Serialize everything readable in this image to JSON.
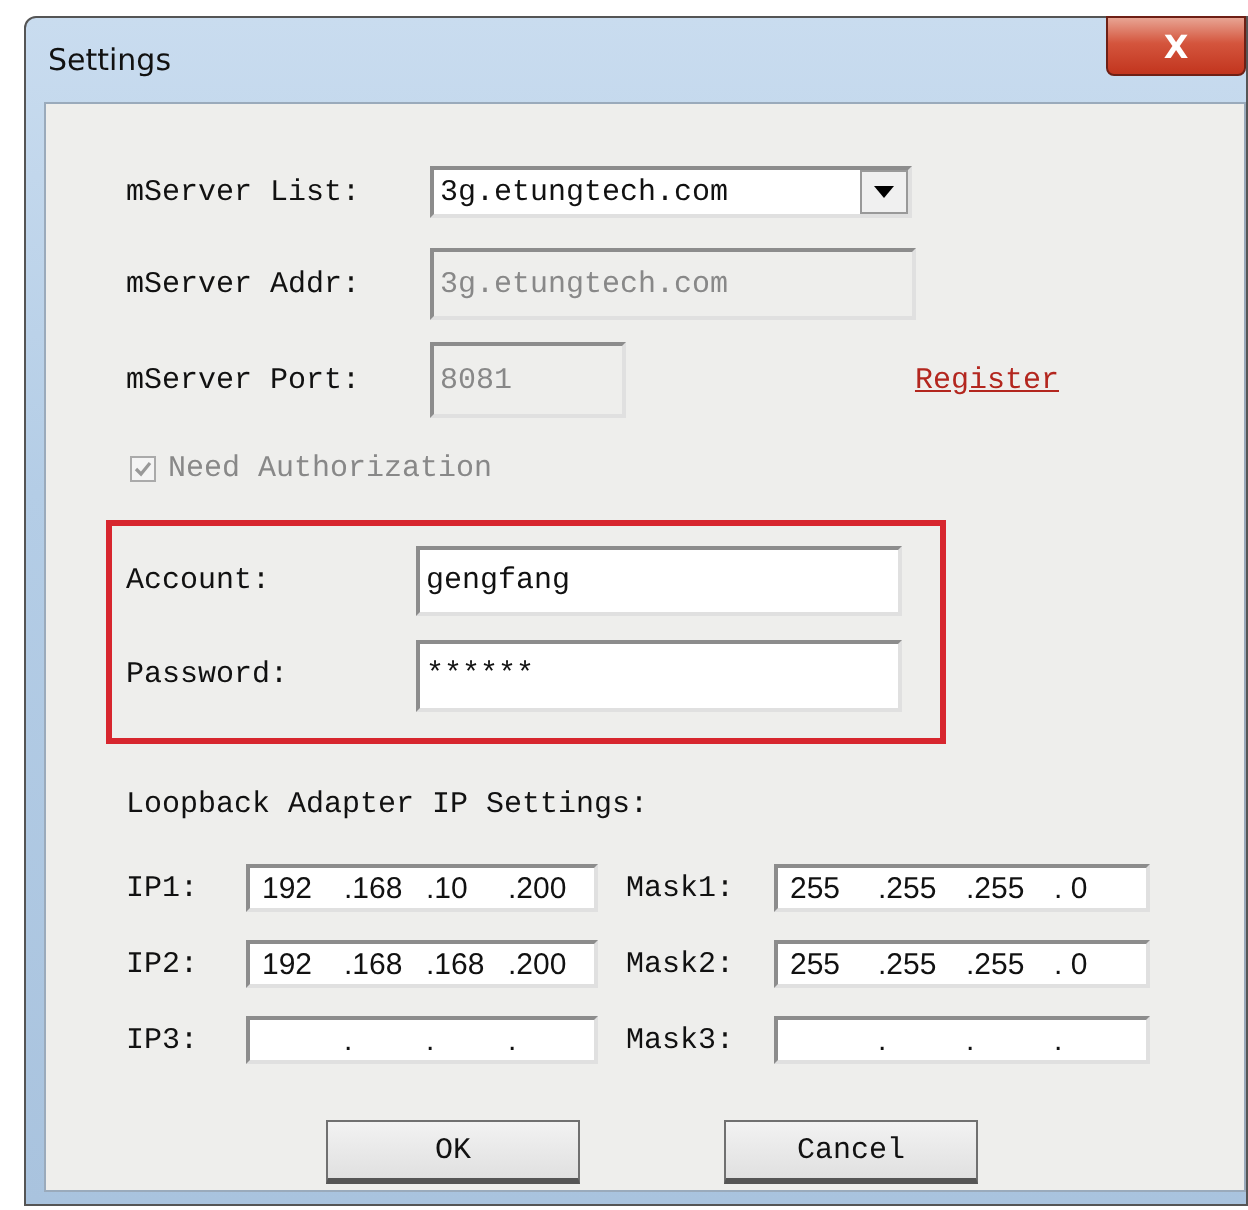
{
  "window": {
    "title": "Settings",
    "close": "X"
  },
  "server_list": {
    "label": "mServer List:",
    "value": "3g.etungtech.com"
  },
  "server_addr": {
    "label": "mServer Addr:",
    "value": "3g.etungtech.com",
    "disabled": true
  },
  "server_port": {
    "label": "mServer Port:",
    "value": "8081",
    "disabled": true
  },
  "register_link": "Register",
  "need_authorization": {
    "label": "Need Authorization",
    "checked": true,
    "disabled": true
  },
  "account": {
    "label": "Account:",
    "value": "gengfang"
  },
  "password": {
    "label": "Password:",
    "value": "******"
  },
  "loopback_heading": "Loopback Adapter IP Settings:",
  "adapters": [
    {
      "ip_label": "IP1:",
      "ip": [
        "192",
        ".168",
        ".10",
        ".200"
      ],
      "mask_label": "Mask1:",
      "mask": [
        "255",
        ".255",
        ".255",
        ". 0"
      ]
    },
    {
      "ip_label": "IP2:",
      "ip": [
        "192",
        ".168",
        ".168",
        ".200"
      ],
      "mask_label": "Mask2:",
      "mask": [
        "255",
        ".255",
        ".255",
        ". 0"
      ]
    },
    {
      "ip_label": "IP3:",
      "ip": [
        ".",
        ".",
        "."
      ],
      "mask_label": "Mask3:",
      "mask": [
        ".",
        ".",
        "."
      ]
    }
  ],
  "buttons": [
    "OK",
    "Cancel"
  ]
}
